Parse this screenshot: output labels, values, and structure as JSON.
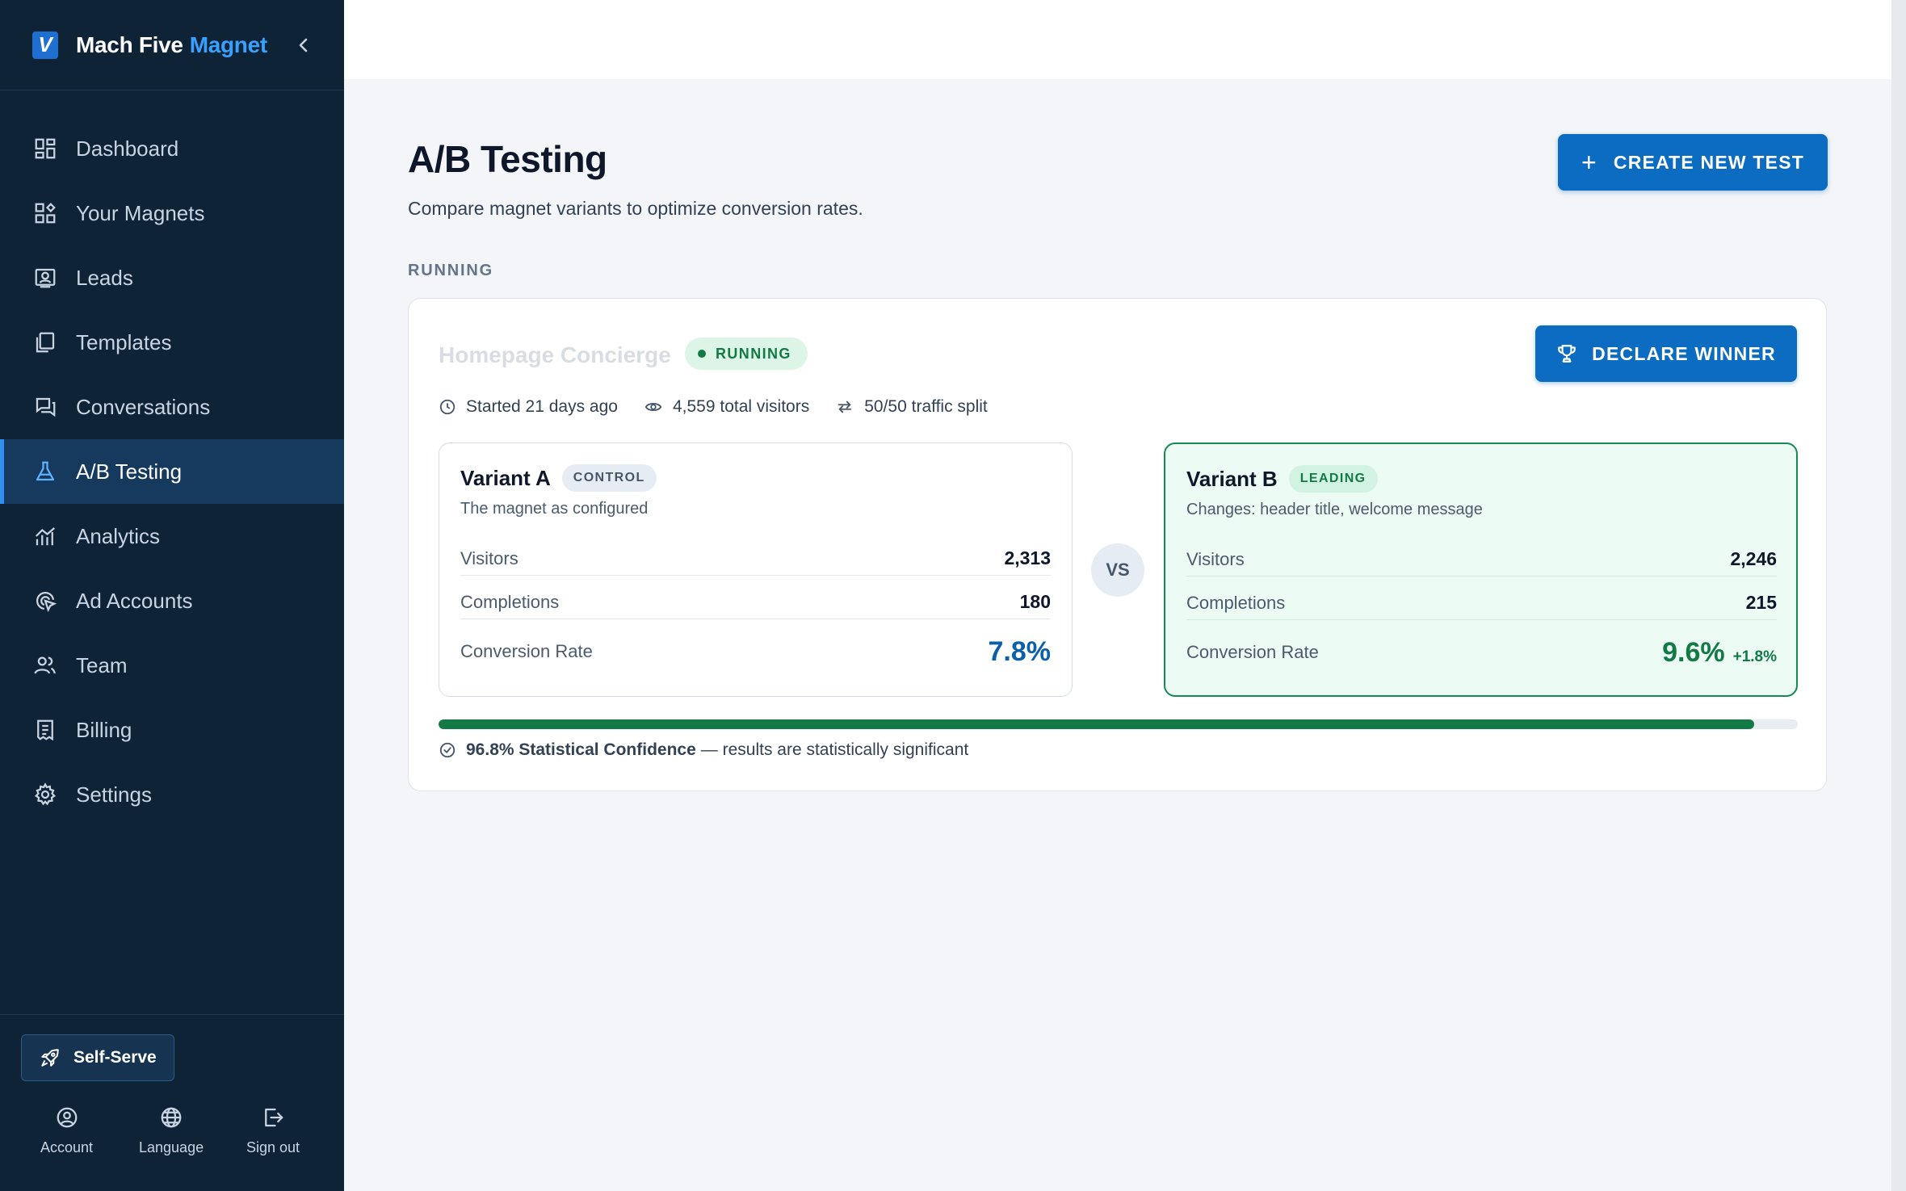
{
  "brand": {
    "logo_letter": "V",
    "name": "Mach Five",
    "accent": "Magnet"
  },
  "sidebar": {
    "items": [
      {
        "label": "Dashboard",
        "icon": "dashboard-icon"
      },
      {
        "label": "Your Magnets",
        "icon": "magnets-icon"
      },
      {
        "label": "Leads",
        "icon": "leads-icon"
      },
      {
        "label": "Templates",
        "icon": "templates-icon"
      },
      {
        "label": "Conversations",
        "icon": "conversations-icon"
      },
      {
        "label": "A/B Testing",
        "icon": "flask-icon",
        "active": true
      },
      {
        "label": "Analytics",
        "icon": "analytics-icon"
      },
      {
        "label": "Ad Accounts",
        "icon": "ad-accounts-icon"
      },
      {
        "label": "Team",
        "icon": "team-icon"
      },
      {
        "label": "Billing",
        "icon": "billing-icon"
      },
      {
        "label": "Settings",
        "icon": "gear-icon"
      }
    ],
    "self_serve_label": "Self-Serve",
    "footer": {
      "account": "Account",
      "language": "Language",
      "sign_out": "Sign out"
    }
  },
  "page": {
    "title": "A/B Testing",
    "subtitle": "Compare magnet variants to optimize conversion rates.",
    "create_button": "CREATE NEW TEST",
    "section_label": "RUNNING"
  },
  "test": {
    "name": "Homepage Concierge",
    "status": "RUNNING",
    "declare_button": "DECLARE WINNER",
    "started": "Started 21 days ago",
    "visitors_total": "4,559 total visitors",
    "traffic_split": "50/50 traffic split",
    "vs_label": "VS",
    "variant_a": {
      "title": "Variant A",
      "badge": "CONTROL",
      "description": "The magnet as configured",
      "visitors_label": "Visitors",
      "visitors": "2,313",
      "completions_label": "Completions",
      "completions": "180",
      "rate_label": "Conversion Rate",
      "rate": "7.8%"
    },
    "variant_b": {
      "title": "Variant B",
      "badge": "LEADING",
      "description": "Changes: header title, welcome message",
      "visitors_label": "Visitors",
      "visitors": "2,246",
      "completions_label": "Completions",
      "completions": "215",
      "rate_label": "Conversion Rate",
      "rate": "9.6%",
      "lift": "+1.8%"
    },
    "confidence": {
      "value": 96.8,
      "label": "96.8% Statistical Confidence",
      "note": "— results are statistically significant"
    }
  },
  "colors": {
    "sidebar_bg": "#0f2337",
    "primary": "#0c6cc2",
    "success": "#127a45",
    "accent_text": "#3aa0ff"
  }
}
